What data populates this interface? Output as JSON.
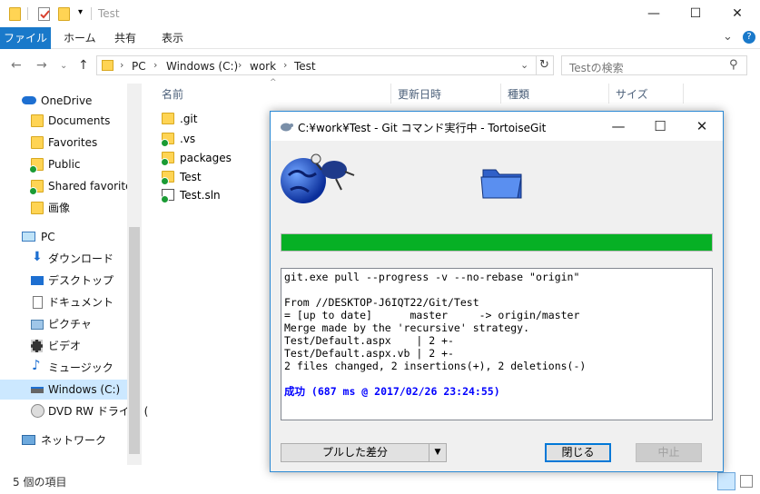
{
  "window": {
    "title": "Test",
    "minimize": "—",
    "maximize": "☐",
    "close": "✕"
  },
  "ribbon": {
    "file": "ファイル",
    "home": "ホーム",
    "share": "共有",
    "view": "表示",
    "expand": "⌄",
    "help": "?"
  },
  "address": {
    "path": [
      "PC",
      "Windows (C:)",
      "work",
      "Test"
    ],
    "search_placeholder": "Testの検索"
  },
  "nav": {
    "items": [
      {
        "label": "OneDrive"
      },
      {
        "label": "Documents"
      },
      {
        "label": "Favorites"
      },
      {
        "label": "Public"
      },
      {
        "label": "Shared favorites"
      },
      {
        "label": "画像"
      },
      {
        "label": "PC"
      },
      {
        "label": "ダウンロード"
      },
      {
        "label": "デスクトップ"
      },
      {
        "label": "ドキュメント"
      },
      {
        "label": "ピクチャ"
      },
      {
        "label": "ビデオ"
      },
      {
        "label": "ミュージック"
      },
      {
        "label": "Windows (C:)"
      },
      {
        "label": "DVD RW ドライブ ("
      },
      {
        "label": "ネットワーク"
      }
    ]
  },
  "columns": {
    "name": "名前",
    "modified": "更新日時",
    "type": "種類",
    "size": "サイズ"
  },
  "files": [
    {
      "name": ".git"
    },
    {
      "name": ".vs"
    },
    {
      "name": "packages"
    },
    {
      "name": "Test"
    },
    {
      "name": "Test.sln"
    }
  ],
  "status": {
    "count": "5 個の項目"
  },
  "dialog": {
    "title": "C:¥work¥Test - Git コマンド実行中 - TortoiseGit",
    "progress_fraction": 1.0,
    "progress_color": "#06b025",
    "log_lines": [
      "git.exe pull --progress -v --no-rebase \"origin\"",
      "",
      "From //DESKTOP-J6IQT22/Git/Test",
      "= [up to date]      master     -> origin/master",
      "Merge made by the 'recursive' strategy.",
      "Test/Default.aspx    | 2 +-",
      "Test/Default.aspx.vb | 2 +-",
      "2 files changed, 2 insertions(+), 2 deletions(-)",
      ""
    ],
    "result_line": "成功 (687 ms @ 2017/02/26 23:24:55)",
    "buttons": {
      "diff": "プルした差分",
      "close": "閉じる",
      "abort": "中止"
    }
  }
}
